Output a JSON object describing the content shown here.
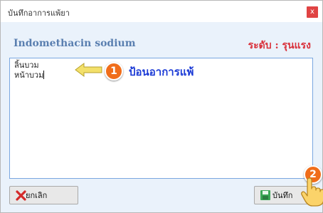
{
  "window": {
    "title": "บันทึกอาการแพ้ยา",
    "close_label": "x"
  },
  "drug_name": "Indomethacin sodium",
  "severity": "ระดับ : รุนแรง",
  "symptoms": {
    "line1": "ลิ้นบวม",
    "line2": "หน้าบวม"
  },
  "annotation": {
    "step1": "1",
    "step1_text": "ป้อนอาการแพ้",
    "step2": "2"
  },
  "buttons": {
    "cancel_label": "ยกเลิก",
    "save_label": "บันทึก"
  },
  "colors": {
    "severity": "#d9313b",
    "drug": "#5a7fb0",
    "badge": "#f06d1a",
    "annotation": "#1c3bd6"
  },
  "icons": {
    "cancel": "x-icon",
    "save": "floppy-disk-icon",
    "pointer": "hand-cursor-icon",
    "arrow": "left-arrow-icon"
  }
}
